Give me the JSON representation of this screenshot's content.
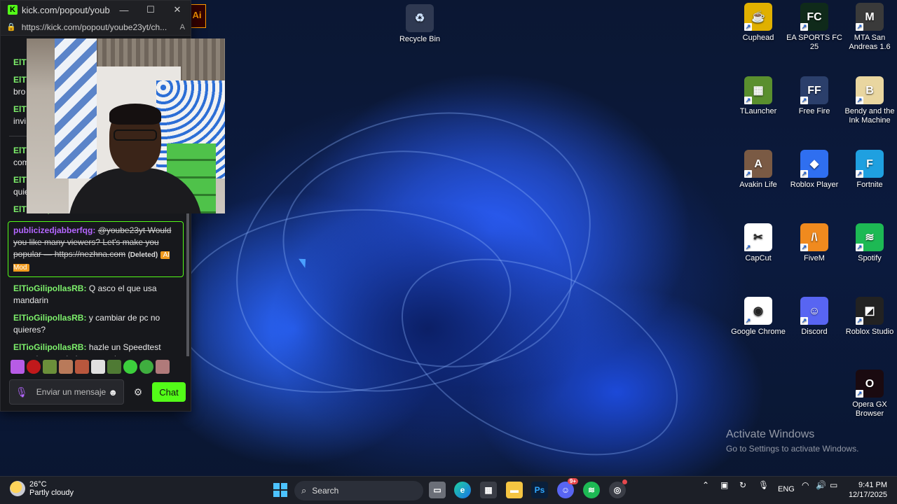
{
  "popout": {
    "window_title": "kick.com/popout/youb...",
    "url": "https://kick.com/popout/yoube23yt/ch...",
    "minimize": "—",
    "maximize": "☐",
    "close": "✕",
    "partial_top_user": "ElTi",
    "partial_lines": [
      {
        "user": "ElTi",
        "text": "bro"
      },
      {
        "user": "ElTi",
        "text": "invi"
      },
      {
        "user": "ElTi",
        "text": "com"
      },
      {
        "user": "ElTi",
        "text": "quie"
      }
    ],
    "messages_tail_user": "ElTioGilipollasRB:",
    "deleted": {
      "user": "publicizedjabberfqg:",
      "text": "@yoube23yt Would you like many viewers? Let's make you popular — https://nezhna.com",
      "deleted_tag": "(Deleted)",
      "ai_tag": "AI Mod"
    },
    "messages": [
      {
        "user": "ElTioGilipollasRB:",
        "text": "Q asco el que usa mandarin"
      },
      {
        "user": "ElTioGilipollasRB:",
        "text": "y cambiar de pc no quieres?"
      },
      {
        "user": "ElTioGilipollasRB:",
        "text": "hazle un Speedtest aver si es verdad que esta bueno"
      }
    ],
    "input_placeholder": "Enviar un mensaje",
    "chat_button": "Chat",
    "emote_colors": [
      "#b75ce6",
      "#c0191b",
      "#6b8f3a",
      "#b97a5a",
      "#b9573d",
      "#e0e0e0",
      "#4f7a34",
      "#3ccf3c",
      "#3fae3f",
      "#b07a7a"
    ]
  },
  "desktop": {
    "recycle_bin": "Recycle Bin",
    "icons": [
      {
        "label": "Cuphead",
        "color": "#e0b000",
        "glyph": "☕"
      },
      {
        "label": "EA SPORTS FC 25",
        "color": "#0f2a1a",
        "glyph": "FC"
      },
      {
        "label": "MTA San Andreas 1.6",
        "color": "#3a3a3a",
        "glyph": "M"
      },
      {
        "label": "TLauncher",
        "color": "#5a8f2e",
        "glyph": "▦"
      },
      {
        "label": "Free Fire",
        "color": "#2b3f6b",
        "glyph": "FF"
      },
      {
        "label": "Bendy and the Ink Machine",
        "color": "#e9d6a0",
        "glyph": "B"
      },
      {
        "label": "Avakin Life",
        "color": "#7a5a44",
        "glyph": "A"
      },
      {
        "label": "Roblox Player",
        "color": "#2f6ff0",
        "glyph": "◆"
      },
      {
        "label": "Fortnite",
        "color": "#1fa0e0",
        "glyph": "F"
      },
      {
        "label": "CapCut",
        "color": "#ffffff",
        "glyph": "✂"
      },
      {
        "label": "FiveM",
        "color": "#f08a1e",
        "glyph": "/\\"
      },
      {
        "label": "Spotify",
        "color": "#1db954",
        "glyph": "≋"
      },
      {
        "label": "Google Chrome",
        "color": "#ffffff",
        "glyph": "◉"
      },
      {
        "label": "Discord",
        "color": "#5865f2",
        "glyph": "☺"
      },
      {
        "label": "Roblox Studio",
        "color": "#222222",
        "glyph": "◩"
      },
      {
        "label": "Opera GX Browser",
        "color": "#1a0a10",
        "glyph": "O"
      }
    ],
    "partial_icon_label": "Ai"
  },
  "activation": {
    "title": "Activate Windows",
    "subtitle": "Go to Settings to activate Windows."
  },
  "taskbar": {
    "temperature": "26°C",
    "weather": "Partly cloudy",
    "search_placeholder": "Search",
    "language": "ENG",
    "time": "9:41 PM",
    "date": "12/17/2025",
    "discord_badge": "9+"
  }
}
